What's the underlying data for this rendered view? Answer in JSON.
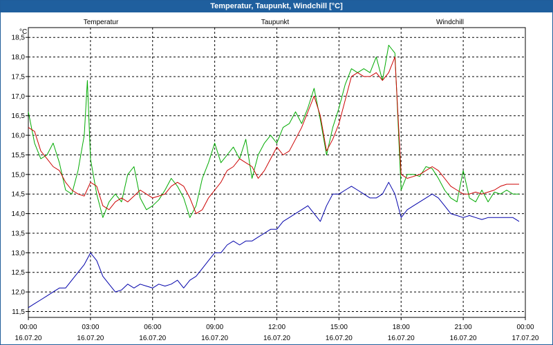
{
  "window": {
    "title": "Temperatur, Taupunkt, Windchill [°C]"
  },
  "colors": {
    "titlebar": "#1f5f9e",
    "grid": "#000000"
  },
  "chart_data": {
    "type": "line",
    "title": "Temperatur, Taupunkt, Windchill [°C]",
    "ylabel": "°C",
    "ylim": [
      11.35,
      18.75
    ],
    "xlim": [
      0,
      24
    ],
    "grid": true,
    "legend_position": "top",
    "y_ticks": [
      {
        "value": 11.5,
        "label": "11,5"
      },
      {
        "value": 12.0,
        "label": "12,0"
      },
      {
        "value": 12.5,
        "label": "12,5"
      },
      {
        "value": 13.0,
        "label": "13,0"
      },
      {
        "value": 13.5,
        "label": "13,5"
      },
      {
        "value": 14.0,
        "label": "14,0"
      },
      {
        "value": 14.5,
        "label": "14,5"
      },
      {
        "value": 15.0,
        "label": "15,0"
      },
      {
        "value": 15.5,
        "label": "15,5"
      },
      {
        "value": 16.0,
        "label": "16,0"
      },
      {
        "value": 16.5,
        "label": "16,5"
      },
      {
        "value": 17.0,
        "label": "17,0"
      },
      {
        "value": 17.5,
        "label": "17,5"
      },
      {
        "value": 18.0,
        "label": "18,0"
      },
      {
        "value": 18.5,
        "label": "18,5"
      }
    ],
    "x_ticks": [
      {
        "value": 0,
        "time": "00:00",
        "date": "16.07.20"
      },
      {
        "value": 3,
        "time": "03:00",
        "date": "16.07.20"
      },
      {
        "value": 6,
        "time": "06:00",
        "date": "16.07.20"
      },
      {
        "value": 9,
        "time": "09:00",
        "date": "16.07.20"
      },
      {
        "value": 12,
        "time": "12:00",
        "date": "16.07.20"
      },
      {
        "value": 15,
        "time": "15:00",
        "date": "16.07.20"
      },
      {
        "value": 18,
        "time": "18:00",
        "date": "16.07.20"
      },
      {
        "value": 21,
        "time": "21:00",
        "date": "16.07.20"
      },
      {
        "value": 24,
        "time": "00:00",
        "date": "17.07.20"
      }
    ],
    "series": [
      {
        "name": "Temperatur",
        "color": "#cc0000",
        "points": [
          [
            0.0,
            16.2
          ],
          [
            0.3,
            16.1
          ],
          [
            0.6,
            15.6
          ],
          [
            0.9,
            15.4
          ],
          [
            1.2,
            15.2
          ],
          [
            1.5,
            15.1
          ],
          [
            1.8,
            14.8
          ],
          [
            2.1,
            14.6
          ],
          [
            2.4,
            14.5
          ],
          [
            2.7,
            14.45
          ],
          [
            3.0,
            14.8
          ],
          [
            3.3,
            14.7
          ],
          [
            3.6,
            14.2
          ],
          [
            3.9,
            14.1
          ],
          [
            4.2,
            14.3
          ],
          [
            4.5,
            14.4
          ],
          [
            4.8,
            14.3
          ],
          [
            5.1,
            14.45
          ],
          [
            5.4,
            14.6
          ],
          [
            5.7,
            14.5
          ],
          [
            6.0,
            14.4
          ],
          [
            6.3,
            14.45
          ],
          [
            6.6,
            14.5
          ],
          [
            6.9,
            14.7
          ],
          [
            7.2,
            14.8
          ],
          [
            7.5,
            14.7
          ],
          [
            7.8,
            14.4
          ],
          [
            8.1,
            14.0
          ],
          [
            8.4,
            14.1
          ],
          [
            8.7,
            14.4
          ],
          [
            9.0,
            14.6
          ],
          [
            9.3,
            14.8
          ],
          [
            9.6,
            15.1
          ],
          [
            9.9,
            15.2
          ],
          [
            10.2,
            15.4
          ],
          [
            10.5,
            15.3
          ],
          [
            10.8,
            15.2
          ],
          [
            11.1,
            14.9
          ],
          [
            11.4,
            15.1
          ],
          [
            11.7,
            15.4
          ],
          [
            12.0,
            15.7
          ],
          [
            12.3,
            15.5
          ],
          [
            12.6,
            15.6
          ],
          [
            12.9,
            15.9
          ],
          [
            13.2,
            16.2
          ],
          [
            13.5,
            16.6
          ],
          [
            13.8,
            17.0
          ],
          [
            14.1,
            16.5
          ],
          [
            14.4,
            15.6
          ],
          [
            14.7,
            15.9
          ],
          [
            15.0,
            16.3
          ],
          [
            15.3,
            16.9
          ],
          [
            15.6,
            17.5
          ],
          [
            15.9,
            17.6
          ],
          [
            16.2,
            17.5
          ],
          [
            16.5,
            17.5
          ],
          [
            16.8,
            17.6
          ],
          [
            17.1,
            17.4
          ],
          [
            17.4,
            17.6
          ],
          [
            17.7,
            18.0
          ],
          [
            18.0,
            15.0
          ],
          [
            18.3,
            14.9
          ],
          [
            18.6,
            14.95
          ],
          [
            18.9,
            15.0
          ],
          [
            19.2,
            15.1
          ],
          [
            19.5,
            15.2
          ],
          [
            19.8,
            15.1
          ],
          [
            20.1,
            14.9
          ],
          [
            20.4,
            14.7
          ],
          [
            20.7,
            14.6
          ],
          [
            21.0,
            14.5
          ],
          [
            21.3,
            14.5
          ],
          [
            21.6,
            14.55
          ],
          [
            21.9,
            14.5
          ],
          [
            22.2,
            14.55
          ],
          [
            22.5,
            14.6
          ],
          [
            22.8,
            14.7
          ],
          [
            23.1,
            14.75
          ],
          [
            23.4,
            14.75
          ],
          [
            23.7,
            14.75
          ]
        ]
      },
      {
        "name": "Taupunkt",
        "color": "#0000aa",
        "points": [
          [
            0.0,
            11.6
          ],
          [
            0.3,
            11.7
          ],
          [
            0.6,
            11.8
          ],
          [
            0.9,
            11.9
          ],
          [
            1.2,
            12.0
          ],
          [
            1.5,
            12.1
          ],
          [
            1.8,
            12.1
          ],
          [
            2.1,
            12.3
          ],
          [
            2.4,
            12.5
          ],
          [
            2.7,
            12.7
          ],
          [
            3.0,
            13.0
          ],
          [
            3.3,
            12.8
          ],
          [
            3.6,
            12.4
          ],
          [
            3.9,
            12.2
          ],
          [
            4.2,
            12.0
          ],
          [
            4.5,
            12.05
          ],
          [
            4.8,
            12.2
          ],
          [
            5.1,
            12.1
          ],
          [
            5.4,
            12.2
          ],
          [
            5.7,
            12.15
          ],
          [
            6.0,
            12.1
          ],
          [
            6.3,
            12.2
          ],
          [
            6.6,
            12.15
          ],
          [
            6.9,
            12.2
          ],
          [
            7.2,
            12.3
          ],
          [
            7.5,
            12.1
          ],
          [
            7.8,
            12.3
          ],
          [
            8.1,
            12.4
          ],
          [
            8.4,
            12.6
          ],
          [
            8.7,
            12.8
          ],
          [
            9.0,
            13.0
          ],
          [
            9.3,
            13.0
          ],
          [
            9.6,
            13.2
          ],
          [
            9.9,
            13.3
          ],
          [
            10.2,
            13.2
          ],
          [
            10.5,
            13.3
          ],
          [
            10.8,
            13.3
          ],
          [
            11.1,
            13.4
          ],
          [
            11.4,
            13.5
          ],
          [
            11.7,
            13.6
          ],
          [
            12.0,
            13.6
          ],
          [
            12.3,
            13.8
          ],
          [
            12.6,
            13.9
          ],
          [
            12.9,
            14.0
          ],
          [
            13.2,
            14.1
          ],
          [
            13.5,
            14.2
          ],
          [
            13.8,
            14.0
          ],
          [
            14.1,
            13.8
          ],
          [
            14.4,
            14.2
          ],
          [
            14.7,
            14.5
          ],
          [
            15.0,
            14.5
          ],
          [
            15.3,
            14.6
          ],
          [
            15.6,
            14.7
          ],
          [
            15.9,
            14.6
          ],
          [
            16.2,
            14.5
          ],
          [
            16.5,
            14.4
          ],
          [
            16.8,
            14.4
          ],
          [
            17.1,
            14.5
          ],
          [
            17.4,
            14.8
          ],
          [
            17.7,
            14.5
          ],
          [
            18.0,
            13.9
          ],
          [
            18.3,
            14.1
          ],
          [
            18.6,
            14.2
          ],
          [
            18.9,
            14.3
          ],
          [
            19.2,
            14.4
          ],
          [
            19.5,
            14.5
          ],
          [
            19.8,
            14.4
          ],
          [
            20.1,
            14.2
          ],
          [
            20.4,
            14.0
          ],
          [
            20.7,
            13.95
          ],
          [
            21.0,
            13.9
          ],
          [
            21.3,
            13.95
          ],
          [
            21.6,
            13.9
          ],
          [
            21.9,
            13.85
          ],
          [
            22.2,
            13.9
          ],
          [
            22.5,
            13.9
          ],
          [
            22.8,
            13.9
          ],
          [
            23.1,
            13.9
          ],
          [
            23.4,
            13.9
          ],
          [
            23.7,
            13.8
          ]
        ]
      },
      {
        "name": "Windchill",
        "color": "#00aa00",
        "points": [
          [
            0.0,
            16.6
          ],
          [
            0.3,
            15.8
          ],
          [
            0.6,
            15.4
          ],
          [
            0.9,
            15.5
          ],
          [
            1.2,
            15.8
          ],
          [
            1.5,
            15.3
          ],
          [
            1.8,
            14.6
          ],
          [
            2.1,
            14.5
          ],
          [
            2.4,
            15.1
          ],
          [
            2.7,
            16.0
          ],
          [
            2.85,
            17.4
          ],
          [
            3.0,
            15.4
          ],
          [
            3.3,
            14.5
          ],
          [
            3.6,
            13.9
          ],
          [
            3.9,
            14.3
          ],
          [
            4.2,
            14.5
          ],
          [
            4.5,
            14.3
          ],
          [
            4.8,
            15.0
          ],
          [
            5.1,
            15.2
          ],
          [
            5.4,
            14.4
          ],
          [
            5.7,
            14.1
          ],
          [
            6.0,
            14.2
          ],
          [
            6.3,
            14.35
          ],
          [
            6.6,
            14.6
          ],
          [
            6.9,
            14.9
          ],
          [
            7.2,
            14.7
          ],
          [
            7.5,
            14.4
          ],
          [
            7.8,
            13.9
          ],
          [
            8.1,
            14.2
          ],
          [
            8.4,
            14.9
          ],
          [
            8.7,
            15.3
          ],
          [
            9.0,
            15.8
          ],
          [
            9.3,
            15.3
          ],
          [
            9.6,
            15.5
          ],
          [
            9.9,
            15.7
          ],
          [
            10.2,
            15.4
          ],
          [
            10.5,
            15.9
          ],
          [
            10.8,
            14.9
          ],
          [
            11.1,
            15.5
          ],
          [
            11.4,
            15.8
          ],
          [
            11.7,
            16.0
          ],
          [
            12.0,
            15.8
          ],
          [
            12.3,
            16.2
          ],
          [
            12.6,
            16.3
          ],
          [
            12.9,
            16.6
          ],
          [
            13.2,
            16.3
          ],
          [
            13.5,
            16.7
          ],
          [
            13.8,
            17.2
          ],
          [
            14.1,
            16.4
          ],
          [
            14.4,
            15.5
          ],
          [
            14.7,
            16.2
          ],
          [
            15.0,
            16.7
          ],
          [
            15.3,
            17.3
          ],
          [
            15.6,
            17.7
          ],
          [
            15.9,
            17.6
          ],
          [
            16.2,
            17.7
          ],
          [
            16.5,
            17.6
          ],
          [
            16.8,
            18.0
          ],
          [
            17.1,
            17.4
          ],
          [
            17.4,
            18.3
          ],
          [
            17.7,
            18.1
          ],
          [
            18.0,
            14.6
          ],
          [
            18.3,
            15.0
          ],
          [
            18.6,
            15.0
          ],
          [
            18.9,
            14.95
          ],
          [
            19.2,
            15.2
          ],
          [
            19.5,
            15.15
          ],
          [
            19.8,
            14.9
          ],
          [
            20.1,
            14.6
          ],
          [
            20.4,
            14.4
          ],
          [
            20.7,
            14.3
          ],
          [
            21.0,
            15.1
          ],
          [
            21.3,
            14.4
          ],
          [
            21.6,
            14.3
          ],
          [
            21.9,
            14.6
          ],
          [
            22.2,
            14.3
          ],
          [
            22.5,
            14.55
          ],
          [
            22.8,
            14.5
          ],
          [
            23.1,
            14.6
          ],
          [
            23.4,
            14.5
          ],
          [
            23.7,
            14.5
          ]
        ]
      }
    ]
  }
}
